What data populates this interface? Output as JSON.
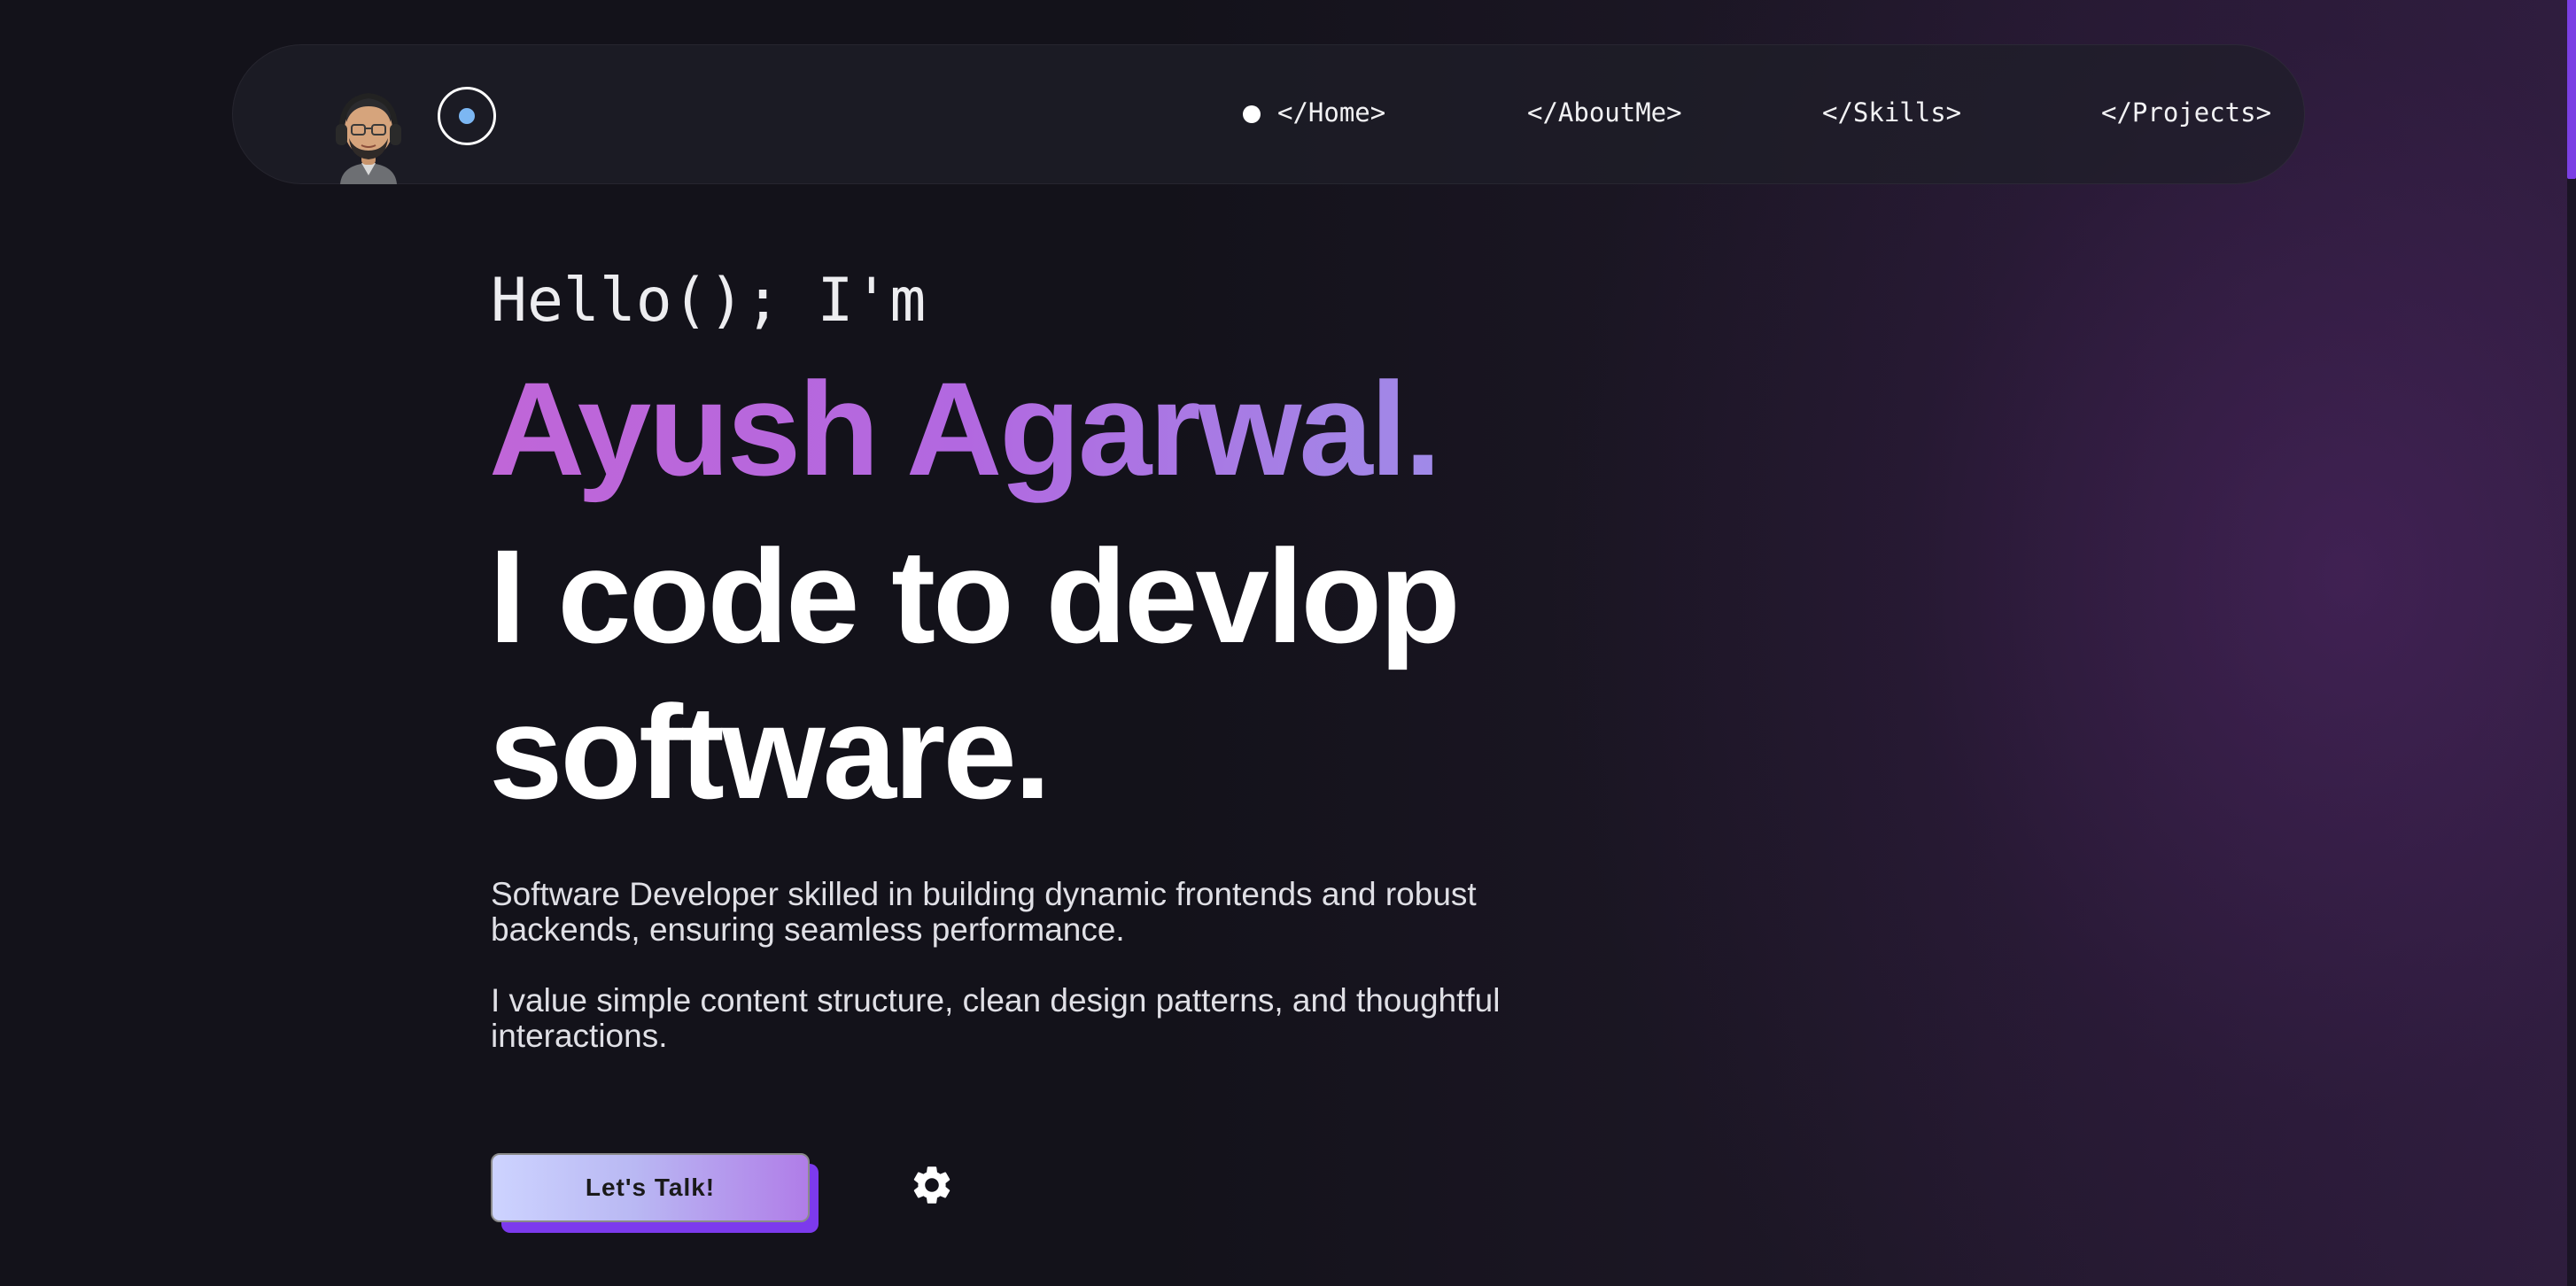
{
  "nav": {
    "links": [
      {
        "label": "</Home>",
        "active": true
      },
      {
        "label": "</AboutMe>",
        "active": false
      },
      {
        "label": "</Skills>",
        "active": false
      },
      {
        "label": "</Projects>",
        "active": false
      }
    ]
  },
  "hero": {
    "greeting": "Hello(); I'm",
    "name": "Ayush Agarwal.",
    "tagline_line1": "I code to devlop",
    "tagline_line2": "software.",
    "description_1": "Software Developer skilled in building dynamic frontends and robust backends, ensuring seamless performance.",
    "description_2": "I value simple content structure, clean design patterns, and thoughtful interactions.",
    "cta_label": "Let's Talk!"
  },
  "icons": {
    "avatar": "memoji-avatar",
    "theme": "theme-toggle-icon",
    "settings": "gear-icon"
  },
  "colors": {
    "background": "#13121a",
    "accent": "#7c3aed",
    "name_gradient_start": "#c066d8",
    "name_gradient_end": "#a08ae8",
    "toggle_dot": "#7cb7f3"
  }
}
